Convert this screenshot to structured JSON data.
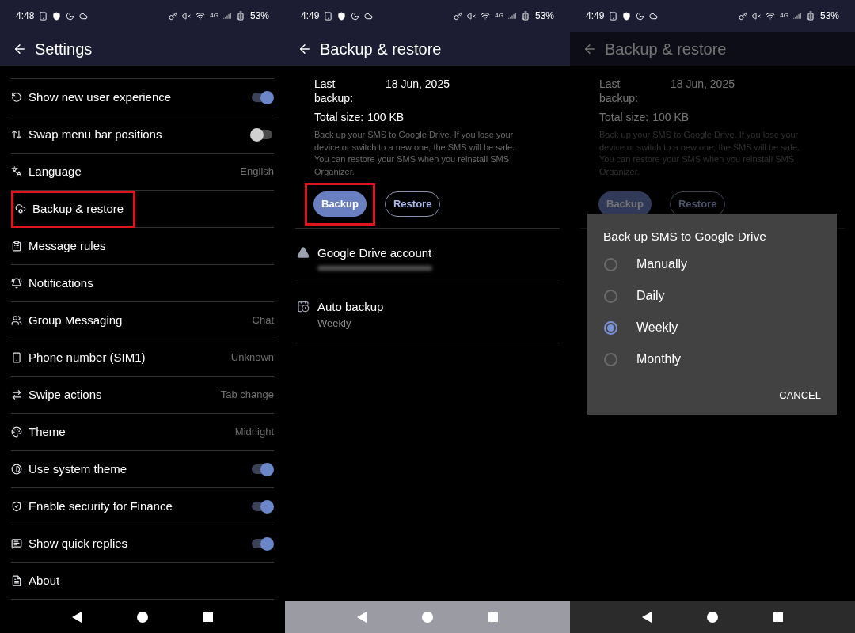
{
  "screens": [
    {
      "kind": "settings",
      "status_bar": {
        "time": "4:48",
        "network": "4G",
        "battery": "53%"
      },
      "title": "Settings",
      "items": [
        {
          "label": "Show new user experience",
          "kind": "toggle",
          "on": true,
          "highlighted": false
        },
        {
          "label": "Swap menu bar positions",
          "kind": "toggle",
          "on": false,
          "highlighted": false
        },
        {
          "label": "Language",
          "kind": "value",
          "value": "English",
          "highlighted": false
        },
        {
          "label": "Backup & restore",
          "kind": "link",
          "highlighted": true
        },
        {
          "label": "Message rules",
          "kind": "link",
          "highlighted": false
        },
        {
          "label": "Notifications",
          "kind": "link",
          "highlighted": false
        },
        {
          "label": "Group Messaging",
          "kind": "value",
          "value": "Chat",
          "highlighted": false
        },
        {
          "label": "Phone number (SIM1)",
          "kind": "value",
          "value": "Unknown",
          "highlighted": false
        },
        {
          "label": "Swipe actions",
          "kind": "value",
          "value": "Tab change",
          "highlighted": false
        },
        {
          "label": "Theme",
          "kind": "value",
          "value": "Midnight",
          "highlighted": false
        },
        {
          "label": "Use system theme",
          "kind": "toggle",
          "on": true,
          "highlighted": false
        },
        {
          "label": "Enable security for Finance",
          "kind": "toggle",
          "on": true,
          "highlighted": false
        },
        {
          "label": "Show quick replies",
          "kind": "toggle",
          "on": true,
          "highlighted": false
        },
        {
          "label": "About",
          "kind": "link",
          "highlighted": false
        }
      ]
    },
    {
      "kind": "backup",
      "status_bar": {
        "time": "4:49",
        "network": "4G",
        "battery": "53%"
      },
      "title": "Backup & restore",
      "last_backup": {
        "label": "Last backup:",
        "value": "18 Jun, 2025"
      },
      "total_size": {
        "label": "Total size:",
        "value": "100 KB"
      },
      "description": "Back up your SMS to Google Drive. If you lose your device or switch to a new one, the SMS will be safe. You can restore your SMS when you reinstall SMS Organizer.",
      "buttons": [
        {
          "label": "Backup",
          "kind": "filled",
          "highlighted": true
        },
        {
          "label": "Restore",
          "kind": "outlined",
          "highlighted": false
        }
      ],
      "rows": [
        {
          "title": "Google Drive account",
          "kind": "account"
        },
        {
          "title": "Auto backup",
          "subtitle": "Weekly",
          "kind": "schedule"
        }
      ]
    },
    {
      "kind": "backup",
      "dimmed": true,
      "status_bar": {
        "time": "4:49",
        "network": "4G",
        "battery": "53%"
      },
      "title": "Backup & restore",
      "last_backup": {
        "label": "Last backup:",
        "value": "18 Jun, 2025"
      },
      "total_size": {
        "label": "Total size:",
        "value": "100 KB"
      },
      "description": "Back up your SMS to Google Drive. If you lose your device or switch to a new one, the SMS will be safe. You can restore your SMS when you reinstall SMS Organizer.",
      "buttons": [
        {
          "label": "Backup",
          "kind": "filled",
          "highlighted": false
        },
        {
          "label": "Restore",
          "kind": "outlined",
          "highlighted": false
        }
      ],
      "dialog": {
        "title": "Back up SMS to Google Drive",
        "options": [
          {
            "label": "Manually",
            "selected": false
          },
          {
            "label": "Daily",
            "selected": false
          },
          {
            "label": "Weekly",
            "selected": true
          },
          {
            "label": "Monthly",
            "selected": false
          }
        ],
        "action": "CANCEL"
      }
    }
  ]
}
